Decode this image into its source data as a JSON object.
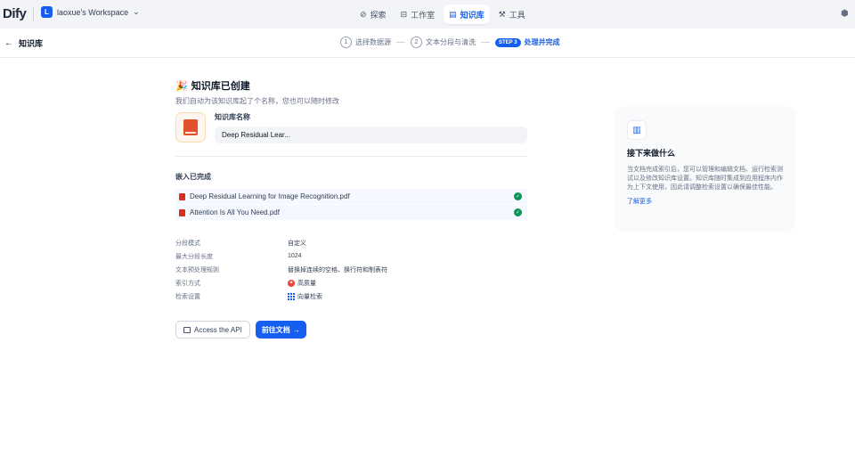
{
  "header": {
    "logo": "Dify",
    "workspace": {
      "initial": "L",
      "name": "laoxue's Workspace",
      "chevron": "chevron-down-icon"
    },
    "nav": [
      {
        "label": "探索",
        "icon": "compass-icon"
      },
      {
        "label": "工作室",
        "icon": "robot-icon"
      },
      {
        "label": "知识库",
        "icon": "book-icon",
        "active": true
      },
      {
        "label": "工具",
        "icon": "tools-icon"
      }
    ],
    "corner_icon": "cube-icon"
  },
  "subheader": {
    "back_label": "知识库",
    "steps": [
      {
        "num": "1",
        "label": "选择数据源"
      },
      {
        "num": "2",
        "label": "文本分段与清洗"
      },
      {
        "num": "STEP 3",
        "label": "处理并完成",
        "active": true
      }
    ]
  },
  "main": {
    "title": "知识库已创建",
    "subtitle": "我们自动为该知识库起了个名称，您也可以随时修改",
    "kb_name_label": "知识库名称",
    "kb_name_value": "Deep Residual Lear...",
    "embed_title": "嵌入已完成",
    "files": [
      {
        "name": "Deep Residual Learning for Image Recognition.pdf",
        "status": "done"
      },
      {
        "name": "Attention Is All You Need.pdf",
        "status": "done"
      }
    ],
    "props": [
      {
        "label": "分段模式",
        "value": "自定义"
      },
      {
        "label": "最大分段长度",
        "value": "1024"
      },
      {
        "label": "文本预处理规则",
        "value": "替换掉连续的空格、换行符和制表符"
      },
      {
        "label": "索引方式",
        "value": "高质量"
      },
      {
        "label": "检索设置",
        "value": "向量检索"
      }
    ],
    "api_button": "Access the API",
    "doc_button": "前往文档"
  },
  "side": {
    "title": "接下来做什么",
    "text": "当文档完成索引后，您可以管理和编辑文档、运行检索测试以及修改知识库设置。知识库随时集成到应用程序内作为上下文使用，因此请调整检索设置以确保最佳性能。",
    "link": "了解更多"
  },
  "colors": {
    "accent": "#155eef",
    "success": "#079455",
    "pdf": "#d92d20"
  }
}
